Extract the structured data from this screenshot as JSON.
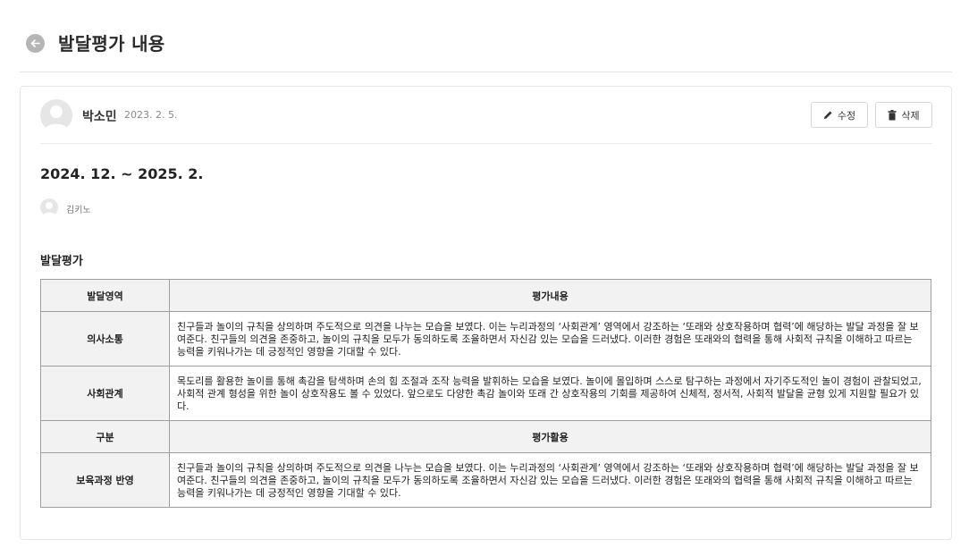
{
  "page": {
    "title": "발달평가 내용"
  },
  "post": {
    "author": "박소민",
    "date": "2023. 2. 5.",
    "edit_label": "수정",
    "delete_label": "삭제",
    "period": "2024. 12. ~ 2025. 2.",
    "teacher": "김키노",
    "section_title": "발달평가"
  },
  "table": {
    "head1": {
      "label": "발달영역",
      "content": "평가내용"
    },
    "rows1": [
      {
        "label": "의사소통",
        "content": "친구들과 놀이의 규칙을 상의하며 주도적으로 의견을 나누는 모습을 보였다. 이는 누리과정의 ‘사회관계’ 영역에서 강조하는 ‘또래와 상호작용하며 협력’에 해당하는 발달 과정을 잘 보여준다. 친구들의 의견을 존중하고, 놀이의 규칙을 모두가 동의하도록 조율하면서 자신감 있는 모습을 드러냈다. 이러한 경험은 또래와의 협력을 통해 사회적 규칙을 이해하고 따르는 능력을 키워나가는 데 긍정적인 영향을 기대할 수 있다."
      },
      {
        "label": "사회관계",
        "content": "목도리를 활용한 놀이를 통해 촉감을 탐색하며 손의 힘 조절과 조작 능력을 발휘하는 모습을 보였다. 놀이에 몰입하며 스스로 탐구하는 과정에서 자기주도적인 놀이 경험이 관찰되었고, 사회적 관계 형성을 위한 놀이 상호작용도 볼 수 있었다. 앞으로도 다양한 촉감 놀이와 또래 간 상호작용의 기회를 제공하여 신체적, 정서적, 사회적 발달을 균형 있게 지원할 필요가 있다."
      }
    ],
    "head2": {
      "label": "구분",
      "content": "평가활용"
    },
    "rows2": [
      {
        "label": "보육과정 반영",
        "content": "친구들과 놀이의 규칙을 상의하며 주도적으로 의견을 나누는 모습을 보였다. 이는 누리과정의 ‘사회관계’ 영역에서 강조하는 ‘또래와 상호작용하며 협력’에 해당하는 발달 과정을 잘 보여준다. 친구들의 의견을 존중하고, 놀이의 규칙을 모두가 동의하도록 조율하면서 자신감 있는 모습을 드러냈다. 이러한 경험은 또래와의 협력을 통해 사회적 규칙을 이해하고 따르는 능력을 키워나가는 데 긍정적인 영향을 기대할 수 있다."
      }
    ]
  },
  "icons": {
    "back": "arrow-left-circle-icon",
    "edit": "pencil-icon",
    "delete": "trash-icon",
    "avatar": "user-avatar-icon"
  },
  "colors": {
    "table_header_bg": "#f2f2f2",
    "table_border": "#9e9e9e",
    "back_button": "#b5b5b5"
  }
}
